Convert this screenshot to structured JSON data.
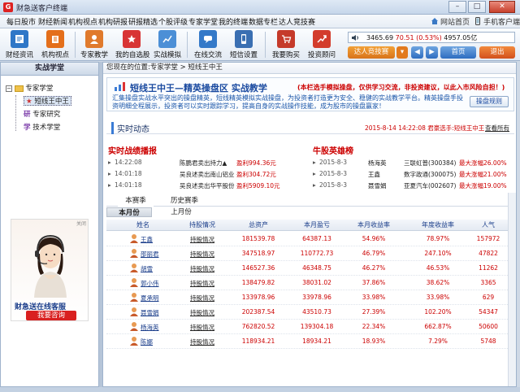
{
  "window": {
    "title": "财急送客户终端",
    "app_icon": "G",
    "minimize": "–",
    "maximize": "□",
    "close": "✕"
  },
  "menu": {
    "items": [
      "每日股市",
      "财经新闻",
      "机构视点",
      "机构研报",
      "研报精选",
      "个股评级",
      "专家学堂",
      "我的终端",
      "数据专栏",
      "达人竞技赛"
    ],
    "site_home": "网站首页",
    "mobile": "手机客户端"
  },
  "toolbar": {
    "buttons": [
      {
        "label": "财经资讯",
        "icon": "finance-news-icon",
        "color": "#2f77c7"
      },
      {
        "label": "机构视点",
        "icon": "institution-view-icon",
        "color": "#e46f1b"
      },
      {
        "label": "专家教学",
        "icon": "expert-teaching-icon",
        "color": "#e07a2c"
      },
      {
        "label": "我的自选股",
        "icon": "my-stocks-icon",
        "color": "#d83434"
      },
      {
        "label": "实战模拟",
        "icon": "simulation-icon",
        "color": "#4c8fd6"
      },
      {
        "label": "在线交流",
        "icon": "online-chat-icon",
        "color": "#3479c8"
      },
      {
        "label": "短信设置",
        "icon": "sms-settings-icon",
        "color": "#3a6fb2"
      },
      {
        "label": "我要购买",
        "icon": "buy-icon",
        "color": "#c53a2a"
      },
      {
        "label": "投资顾问",
        "icon": "advisor-icon",
        "color": "#d33c2c"
      }
    ]
  },
  "ticker": {
    "prefix": "3465.69",
    "change": "70.51",
    "pct": "(0.53%)",
    "volume": "4957.05亿"
  },
  "controls": {
    "contest_btn": "达人竞技赛",
    "home_btn": "首页",
    "exit_btn": "退出"
  },
  "left": {
    "title": "实战学堂",
    "tree": {
      "root": "专家学堂",
      "children": [
        "短线王中王",
        "专家研究",
        "技术学堂"
      ]
    },
    "ad": {
      "title": "财急送在线客服",
      "button": "我要咨询",
      "close": "关闭"
    }
  },
  "breadcrumb": {
    "prefix": "您现在的位置:专家学堂",
    "sep": " > ",
    "current": "短线王中王"
  },
  "banner": {
    "title": "短线王中王—精英操盘区 实战教学",
    "subtitle": "(本栏选手模拟操盘，仅供学习交流，非投资建议，以此入市风险自担！)",
    "desc": "汇集操盘实战水平突出的操盘精英，短线精英模拟实战操盘，为投资者打造更为安全、稳健的实战教学平台。精英操盘手投资明细全程展示，投资者可以实时跟踪学习，提高自身的实战操作技能，成为股市的操盘赢家！",
    "button": "操盘规则"
  },
  "realtime": {
    "title": "实时动态",
    "message_date": "2015-8-14 14:22:08",
    "message": "君豪选手:短线王中王",
    "more": "查看所有"
  },
  "battle": {
    "title": "实时战绩播报",
    "rows": [
      {
        "time": "14:22:08",
        "name": "陈鹏君卖出持力▲",
        "value": "盈利994.36元"
      },
      {
        "time": "14:01:18",
        "name": "吴良述卖出南山铝业",
        "value": "盈利304.72元"
      },
      {
        "time": "14:01:18",
        "name": "吴良述卖出华平股份",
        "value": "盈利5909.10元"
      }
    ]
  },
  "hero": {
    "title": "牛股英雄榜",
    "rows": [
      {
        "date": "2015-8-3",
        "name": "杨海英",
        "stock": "三联虹普(300384)",
        "value": "最大涨幅26.00%"
      },
      {
        "date": "2015-8-3",
        "name": "王鑫",
        "stock": "数字政通(300075)",
        "value": "最大涨幅21.00%"
      },
      {
        "date": "2015-8-3",
        "name": "聂雪娟",
        "stock": "亚夏汽车(002607)",
        "value": "最大涨幅19.00%"
      }
    ]
  },
  "tabs": {
    "season": [
      "本赛季",
      "历史赛季"
    ],
    "month": [
      "本月份",
      "上月份"
    ]
  },
  "table": {
    "headers": [
      "姓名",
      "持股情况",
      "总资产",
      "本月盈亏",
      "本月收益率",
      "年度收益率",
      "人气"
    ],
    "rows": [
      {
        "name": "王鑫",
        "holding": "持股情况",
        "total": "181539.78",
        "pnl": "64387.13",
        "mret": "54.96%",
        "yret": "78.97%",
        "pop": "157972"
      },
      {
        "name": "邵丽君",
        "holding": "持股情况",
        "total": "347518.97",
        "pnl": "110772.73",
        "mret": "46.79%",
        "yret": "247.10%",
        "pop": "47822"
      },
      {
        "name": "胡雪",
        "holding": "持股情况",
        "total": "146527.36",
        "pnl": "46348.75",
        "mret": "46.27%",
        "yret": "46.53%",
        "pop": "11262"
      },
      {
        "name": "郭小伟",
        "holding": "持股情况",
        "total": "138479.82",
        "pnl": "38031.02",
        "mret": "37.86%",
        "yret": "38.62%",
        "pop": "3365"
      },
      {
        "name": "夏承明",
        "holding": "持股情况",
        "total": "133978.96",
        "pnl": "33978.96",
        "mret": "33.98%",
        "yret": "33.98%",
        "pop": "629"
      },
      {
        "name": "聂雪娟",
        "holding": "持股情况",
        "total": "202387.54",
        "pnl": "43510.73",
        "mret": "27.39%",
        "yret": "102.20%",
        "pop": "54347"
      },
      {
        "name": "杨海英",
        "holding": "持股情况",
        "total": "762820.52",
        "pnl": "139304.18",
        "mret": "22.34%",
        "yret": "662.87%",
        "pop": "50600"
      },
      {
        "name": "陈娜",
        "holding": "持股情况",
        "total": "118934.21",
        "pnl": "18934.21",
        "mret": "18.93%",
        "yret": "7.29%",
        "pop": "5748"
      }
    ]
  }
}
